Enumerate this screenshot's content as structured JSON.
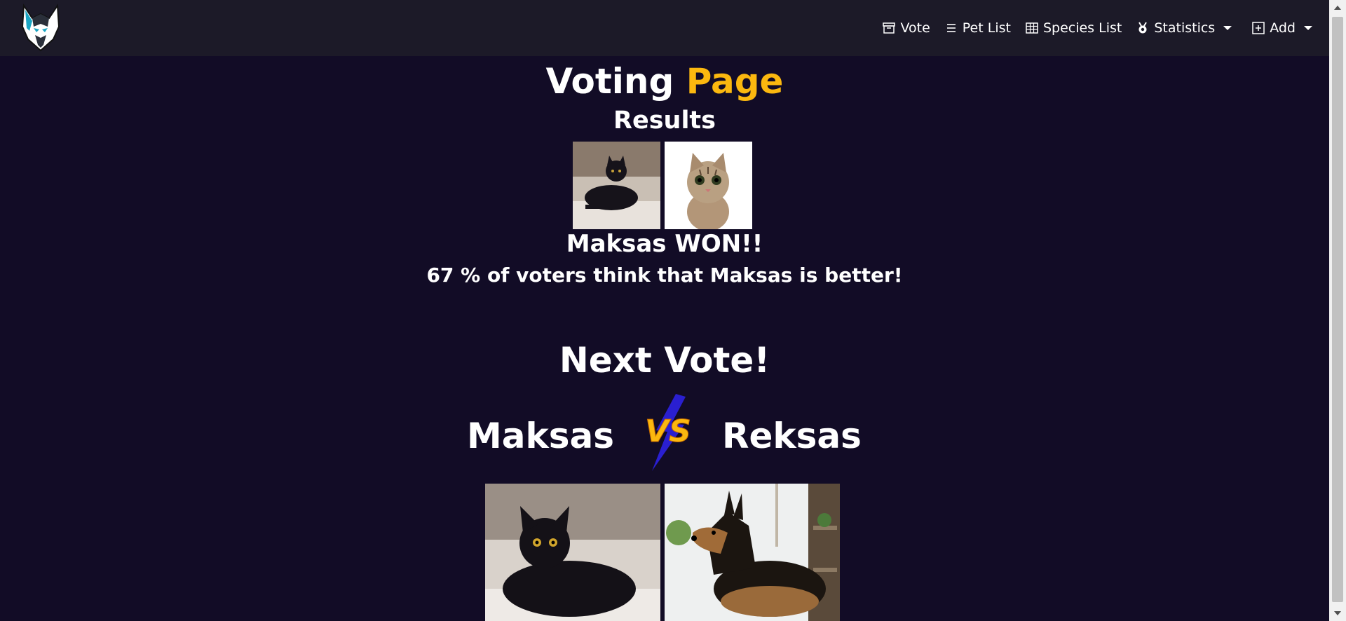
{
  "nav": {
    "items": [
      {
        "label": "Vote",
        "icon": "archive-icon"
      },
      {
        "label": "Pet List",
        "icon": "list-icon"
      },
      {
        "label": "Species List",
        "icon": "table-icon"
      },
      {
        "label": "Statistics",
        "icon": "award-icon"
      },
      {
        "label": "Add",
        "icon": "plus-square-icon"
      }
    ]
  },
  "page": {
    "title_main": "Voting",
    "title_accent": "Page",
    "results_heading": "Results",
    "winner_text": "Maksas WON!!",
    "percent_text": "67 % of voters think that Maksas is better!",
    "next_heading": "Next Vote!",
    "left_name": "Maksas",
    "right_name": "Reksas",
    "vs_text": "VS"
  },
  "colors": {
    "background": "#120c26",
    "navbar": "#1c1a28",
    "accent": "#fbb80f"
  }
}
